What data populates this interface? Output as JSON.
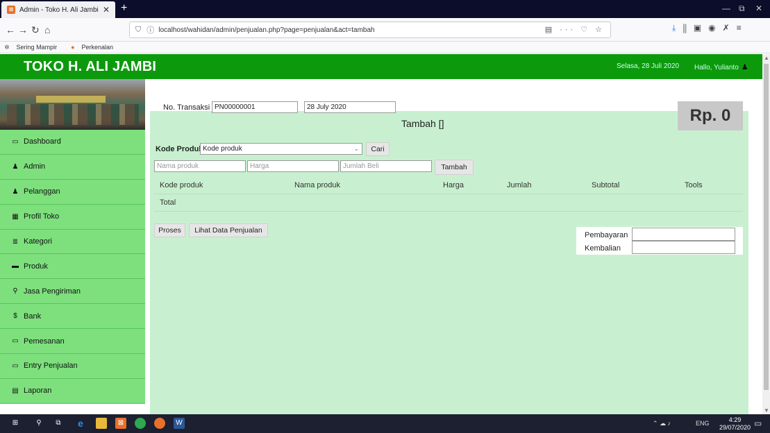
{
  "browser": {
    "tab_title": "Admin - Toko H. Ali Jambi",
    "tab_favicon": "xampp-icon",
    "url": "localhost/wahidan/admin/penjualan.php?page=penjualan&act=tambah",
    "bookmarks": [
      "Sering Mampir",
      "Perkenalan"
    ]
  },
  "header": {
    "brand": "TOKO H. ALI JAMBI",
    "date": "Selasa, 28 Juli 2020",
    "greeting": "Hallo, Yulianto",
    "color": "#0c9a0c"
  },
  "sidebar": {
    "items": [
      {
        "label": "Dashboard",
        "icon": "monitor-icon"
      },
      {
        "label": "Admin",
        "icon": "user-icon"
      },
      {
        "label": "Pelanggan",
        "icon": "users-icon"
      },
      {
        "label": "Profil Toko",
        "icon": "table-icon"
      },
      {
        "label": "Kategori",
        "icon": "list-icon"
      },
      {
        "label": "Produk",
        "icon": "briefcase-icon"
      },
      {
        "label": "Jasa Pengiriman",
        "icon": "map-marker-icon"
      },
      {
        "label": "Bank",
        "icon": "dollar-icon"
      },
      {
        "label": "Pemesanan",
        "icon": "credit-card-icon"
      },
      {
        "label": "Entry Penjualan",
        "icon": "credit-card-icon"
      },
      {
        "label": "Laporan",
        "icon": "file-icon"
      }
    ],
    "color": "#7de07d"
  },
  "form": {
    "transaksi_label": "No. Transaksi :",
    "transaksi_value": "PN00000001",
    "date_value": "28 July 2020",
    "title": "Tambah []",
    "total_display": "Rp. 0",
    "kode_label": "Kode Produk",
    "kode_select": "Kode produk",
    "cari_button": "Cari",
    "nama_placeholder": "Nama produk",
    "harga_placeholder": "Harga",
    "jumlah_placeholder": "Jumlah Beli",
    "tambah_button": "Tambah",
    "table_headers": [
      "Kode produk",
      "Nama produk",
      "Harga",
      "Jumlah",
      "Subtotal",
      "Tools"
    ],
    "total_label": "Total",
    "proses_button": "Proses",
    "lihat_button": "Lihat Data Penjualan",
    "pembayaran_label": "Pembayaran",
    "kembalian_label": "Kembalian"
  },
  "taskbar": {
    "lang": "ENG",
    "time": "4:29",
    "date": "29/07/2020"
  }
}
